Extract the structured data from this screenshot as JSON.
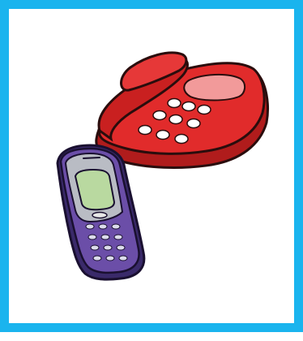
{
  "frame": {
    "border_color": "#1ab4ee",
    "background_color": "#ffffff"
  },
  "illustration": {
    "subject": "telephones",
    "items": [
      {
        "icon": "desk-telephone-icon",
        "color": "#e12b2b"
      },
      {
        "icon": "mobile-phone-icon",
        "color": "#6b4ea8"
      }
    ]
  }
}
